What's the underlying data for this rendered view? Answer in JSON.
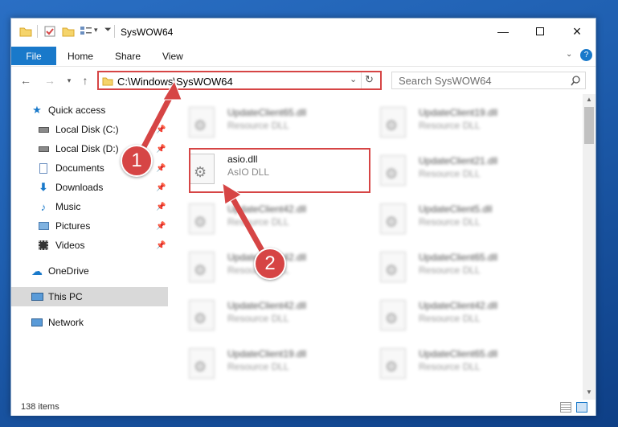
{
  "window": {
    "title": "SysWOW64",
    "minimize_icon": "minimize-icon",
    "maximize_icon": "maximize-icon",
    "close_icon": "close-icon"
  },
  "ribbon": {
    "tabs": [
      {
        "label": "File"
      },
      {
        "label": "Home"
      },
      {
        "label": "Share"
      },
      {
        "label": "View"
      }
    ]
  },
  "navbar": {
    "address": "C:\\Windows\\SysWOW64",
    "search_placeholder": "Search SysWOW64"
  },
  "sidebar": {
    "items": [
      {
        "label": "Quick access"
      },
      {
        "label": "Local Disk (C:)"
      },
      {
        "label": "Local Disk (D:)"
      },
      {
        "label": "Documents"
      },
      {
        "label": "Downloads"
      },
      {
        "label": "Music"
      },
      {
        "label": "Pictures"
      },
      {
        "label": "Videos"
      },
      {
        "label": "OneDrive"
      },
      {
        "label": "This PC"
      },
      {
        "label": "Network"
      }
    ]
  },
  "files": {
    "left": [
      {
        "name": "UpdateClient65.dll",
        "type": "Resource DLL"
      },
      {
        "name": "asio.dll",
        "type": "AsIO DLL"
      },
      {
        "name": "UpdateClient42.dll",
        "type": "Resource DLL"
      },
      {
        "name": "UpdateClient42.dll",
        "type": "Resource DLL"
      },
      {
        "name": "UpdateClient42.dll",
        "type": "Resource DLL"
      },
      {
        "name": "UpdateClient19.dll",
        "type": "Resource DLL"
      }
    ],
    "right": [
      {
        "name": "UpdateClient19.dll",
        "type": "Resource DLL"
      },
      {
        "name": "UpdateClient21.dll",
        "type": "Resource DLL"
      },
      {
        "name": "UpdateClient5.dll",
        "type": "Resource DLL"
      },
      {
        "name": "UpdateClient65.dll",
        "type": "Resource DLL"
      },
      {
        "name": "UpdateClient42.dll",
        "type": "Resource DLL"
      },
      {
        "name": "UpdateClient65.dll",
        "type": "Resource DLL"
      }
    ]
  },
  "status": {
    "item_count": "138 items"
  },
  "callouts": {
    "step1": "1",
    "step2": "2",
    "color": "#d64545"
  }
}
